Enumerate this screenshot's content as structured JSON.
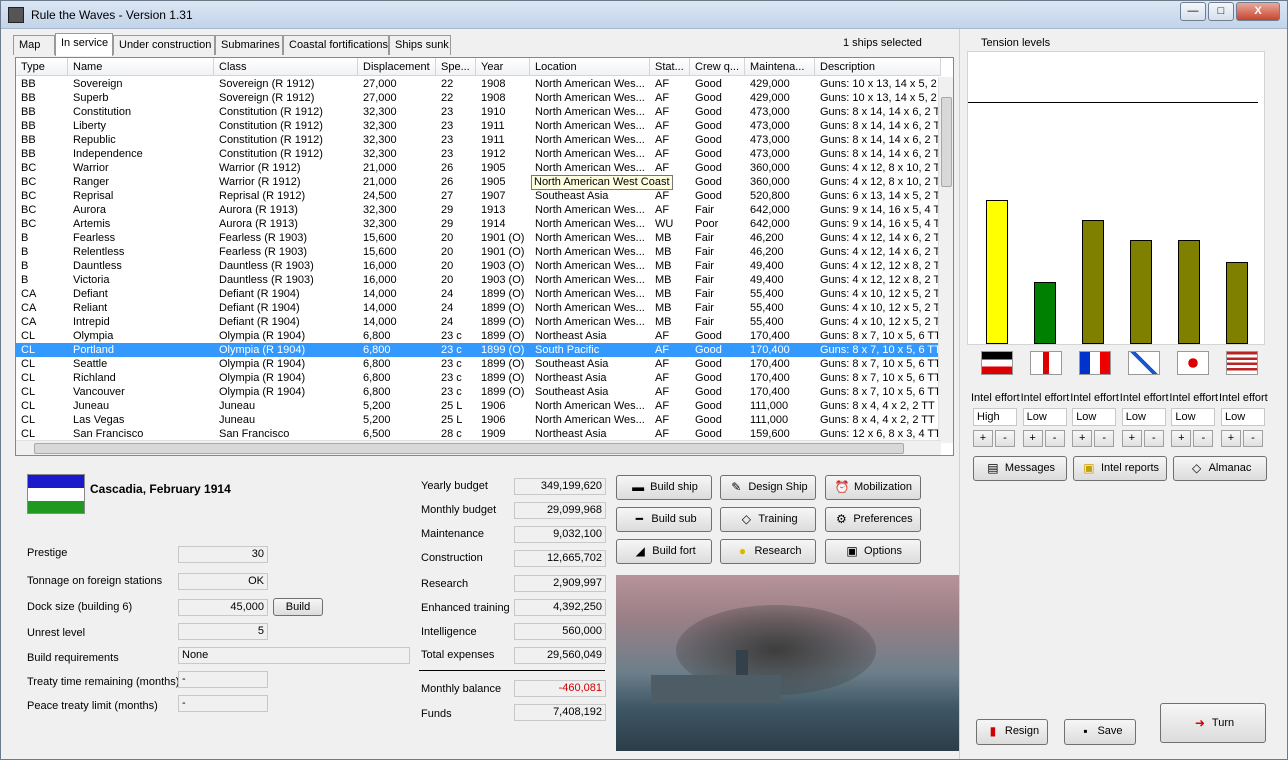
{
  "window": {
    "title": "Rule the Waves - Version 1.31",
    "min": "—",
    "max": "□",
    "close": "X"
  },
  "tabs": [
    "Map",
    "In service",
    "Under construction",
    "Submarines",
    "Coastal fortifications",
    "Ships sunk"
  ],
  "selection_info": "1 ships selected",
  "table": {
    "columns": [
      "Type",
      "Name",
      "Class",
      "Displacement",
      "Spe...",
      "Year",
      "Location",
      "Stat...",
      "Crew q...",
      "Maintena...",
      "Description"
    ],
    "rows": [
      [
        "BB",
        "Sovereign",
        "Sovereign (R 1912)",
        "27,000",
        "22",
        "1908",
        "North American Wes...",
        "AF",
        "Good",
        "429,000",
        "Guns: 10 x 13, 14 x 5, 2"
      ],
      [
        "BB",
        "Superb",
        "Sovereign (R 1912)",
        "27,000",
        "22",
        "1908",
        "North American Wes...",
        "AF",
        "Good",
        "429,000",
        "Guns: 10 x 13, 14 x 5, 2"
      ],
      [
        "BB",
        "Constitution",
        "Constitution (R 1912)",
        "32,300",
        "23",
        "1910",
        "North American Wes...",
        "AF",
        "Good",
        "473,000",
        "Guns: 8 x 14, 14 x 6, 2 T"
      ],
      [
        "BB",
        "Liberty",
        "Constitution (R 1912)",
        "32,300",
        "23",
        "1911",
        "North American Wes...",
        "AF",
        "Good",
        "473,000",
        "Guns: 8 x 14, 14 x 6, 2 T"
      ],
      [
        "BB",
        "Republic",
        "Constitution (R 1912)",
        "32,300",
        "23",
        "1911",
        "North American Wes...",
        "AF",
        "Good",
        "473,000",
        "Guns: 8 x 14, 14 x 6, 2 T"
      ],
      [
        "BB",
        "Independence",
        "Constitution (R 1912)",
        "32,300",
        "23",
        "1912",
        "North American Wes...",
        "AF",
        "Good",
        "473,000",
        "Guns: 8 x 14, 14 x 6, 2 T"
      ],
      [
        "BC",
        "Warrior",
        "Warrior (R 1912)",
        "21,000",
        "26",
        "1905",
        "North American Wes...",
        "AF",
        "Good",
        "360,000",
        "Guns: 4 x 12, 8 x 10, 2 T"
      ],
      [
        "BC",
        "Ranger",
        "Warrior (R 1912)",
        "21,000",
        "26",
        "1905",
        "North American Wes...",
        "AF",
        "Good",
        "360,000",
        "Guns: 4 x 12, 8 x 10, 2 T"
      ],
      [
        "BC",
        "Reprisal",
        "Reprisal (R 1912)",
        "24,500",
        "27",
        "1907",
        "Southeast Asia",
        "AF",
        "Good",
        "520,800",
        "Guns: 6 x 13, 14 x 5, 2 T"
      ],
      [
        "BC",
        "Aurora",
        "Aurora (R 1913)",
        "32,300",
        "29",
        "1913",
        "North American Wes...",
        "AF",
        "Fair",
        "642,000",
        "Guns: 9 x 14, 16 x 5, 4 T"
      ],
      [
        "BC",
        "Artemis",
        "Aurora (R 1913)",
        "32,300",
        "29",
        "1914",
        "North American Wes...",
        "WU",
        "Poor",
        "642,000",
        "Guns: 9 x 14, 16 x 5, 4 T"
      ],
      [
        "B",
        "Fearless",
        "Fearless (R 1903)",
        "15,600",
        "20",
        "1901 (O)",
        "North American Wes...",
        "MB",
        "Fair",
        "46,200",
        "Guns: 4 x 12, 14 x 6, 2 T"
      ],
      [
        "B",
        "Relentless",
        "Fearless (R 1903)",
        "15,600",
        "20",
        "1901 (O)",
        "North American Wes...",
        "MB",
        "Fair",
        "46,200",
        "Guns: 4 x 12, 14 x 6, 2 T"
      ],
      [
        "B",
        "Dauntless",
        "Dauntless (R 1903)",
        "16,000",
        "20",
        "1903 (O)",
        "North American Wes...",
        "MB",
        "Fair",
        "49,400",
        "Guns: 4 x 12, 12 x 8, 2 T"
      ],
      [
        "B",
        "Victoria",
        "Dauntless (R 1903)",
        "16,000",
        "20",
        "1903 (O)",
        "North American Wes...",
        "MB",
        "Fair",
        "49,400",
        "Guns: 4 x 12, 12 x 8, 2 T"
      ],
      [
        "CA",
        "Defiant",
        "Defiant (R 1904)",
        "14,000",
        "24",
        "1899 (O)",
        "North American Wes...",
        "MB",
        "Fair",
        "55,400",
        "Guns: 4 x 10, 12 x 5, 2 T"
      ],
      [
        "CA",
        "Reliant",
        "Defiant (R 1904)",
        "14,000",
        "24",
        "1899 (O)",
        "North American Wes...",
        "MB",
        "Fair",
        "55,400",
        "Guns: 4 x 10, 12 x 5, 2 T"
      ],
      [
        "CA",
        "Intrepid",
        "Defiant (R 1904)",
        "14,000",
        "24",
        "1899 (O)",
        "North American Wes...",
        "MB",
        "Fair",
        "55,400",
        "Guns: 4 x 10, 12 x 5, 2 T"
      ],
      [
        "CL",
        "Olympia",
        "Olympia (R 1904)",
        "6,800",
        "23 c",
        "1899 (O)",
        "Northeast Asia",
        "AF",
        "Good",
        "170,400",
        "Guns: 8 x 7, 10 x 5, 6 TT"
      ],
      [
        "CL",
        "Portland",
        "Olympia (R 1904)",
        "6,800",
        "23 c",
        "1899 (O)",
        "South Pacific",
        "AF",
        "Good",
        "170,400",
        "Guns: 8 x 7, 10 x 5, 6 TT"
      ],
      [
        "CL",
        "Seattle",
        "Olympia (R 1904)",
        "6,800",
        "23 c",
        "1899 (O)",
        "Southeast Asia",
        "AF",
        "Good",
        "170,400",
        "Guns: 8 x 7, 10 x 5, 6 TT"
      ],
      [
        "CL",
        "Richland",
        "Olympia (R 1904)",
        "6,800",
        "23 c",
        "1899 (O)",
        "Northeast Asia",
        "AF",
        "Good",
        "170,400",
        "Guns: 8 x 7, 10 x 5, 6 TT"
      ],
      [
        "CL",
        "Vancouver",
        "Olympia (R 1904)",
        "6,800",
        "23 c",
        "1899 (O)",
        "Southeast Asia",
        "AF",
        "Good",
        "170,400",
        "Guns: 8 x 7, 10 x 5, 6 TT"
      ],
      [
        "CL",
        "Juneau",
        "Juneau",
        "5,200",
        "25 L",
        "1906",
        "North American Wes...",
        "AF",
        "Good",
        "111,000",
        "Guns: 8 x 4, 4 x 2, 2 TT"
      ],
      [
        "CL",
        "Las Vegas",
        "Juneau",
        "5,200",
        "25 L",
        "1906",
        "North American Wes...",
        "AF",
        "Good",
        "111,000",
        "Guns: 8 x 4, 4 x 2, 2 TT"
      ],
      [
        "CL",
        "San Francisco",
        "San Francisco",
        "6,500",
        "28 c",
        "1909",
        "Northeast Asia",
        "AF",
        "Good",
        "159,600",
        "Guns: 12 x 6, 8 x 3, 4 TT"
      ]
    ],
    "selected_row": 19,
    "tooltip": "North American West Coast"
  },
  "nation": {
    "name": "Cascadia, February 1914",
    "flag_colors": [
      "#1a1acc",
      "#ffffff",
      "#1f9a1f"
    ]
  },
  "stats": {
    "prestige_label": "Prestige",
    "prestige": "30",
    "tonnage_label": "Tonnage on foreign stations",
    "tonnage": "OK",
    "dock_label": "Dock size (building 6)",
    "dock": "45,000",
    "build_btn": "Build",
    "unrest_label": "Unrest level",
    "unrest": "5",
    "req_label": "Build requirements",
    "req": "None",
    "treaty_label": "Treaty time remaining (months)",
    "treaty": "-",
    "peace_label": "Peace treaty limit (months)",
    "peace": "-"
  },
  "budget": {
    "yearly_label": "Yearly budget",
    "yearly": "349,199,620",
    "monthly_label": "Monthly budget",
    "monthly": "29,099,968",
    "maint_label": "Maintenance",
    "maint": "9,032,100",
    "constr_label": "Construction",
    "constr": "12,665,702",
    "research_label": "Research",
    "research": "2,909,997",
    "training_label": "Enhanced training",
    "training": "4,392,250",
    "intel_label": "Intelligence",
    "intel": "560,000",
    "total_label": "Total expenses",
    "total": "29,560,049",
    "balance_label": "Monthly balance",
    "balance": "-460,081",
    "funds_label": "Funds",
    "funds": "7,408,192"
  },
  "actions": {
    "build_ship": "Build ship",
    "design_ship": "Design Ship",
    "mobilization": "Mobilization",
    "build_sub": "Build sub",
    "training": "Training",
    "preferences": "Preferences",
    "build_fort": "Build fort",
    "research": "Research",
    "options": "Options"
  },
  "tension": {
    "title": "Tension levels",
    "bars": [
      {
        "nation": "Germany",
        "level": 0.72,
        "color": "#ffff00"
      },
      {
        "nation": "Britain",
        "level": 0.31,
        "color": "#008000"
      },
      {
        "nation": "France",
        "level": 0.62,
        "color": "#808000"
      },
      {
        "nation": "Russia",
        "level": 0.52,
        "color": "#808000"
      },
      {
        "nation": "Japan",
        "level": 0.52,
        "color": "#808000"
      },
      {
        "nation": "USA",
        "level": 0.41,
        "color": "#808000"
      }
    ],
    "intel_label": "Intel effort",
    "intel_values": [
      "High",
      "Low",
      "Low",
      "Low",
      "Low",
      "Low"
    ],
    "plus": "+",
    "minus": "-"
  },
  "side_buttons": {
    "messages": "Messages",
    "intel_reports": "Intel reports",
    "almanac": "Almanac"
  },
  "bottom_buttons": {
    "resign": "Resign",
    "save": "Save",
    "turn": "Turn"
  }
}
